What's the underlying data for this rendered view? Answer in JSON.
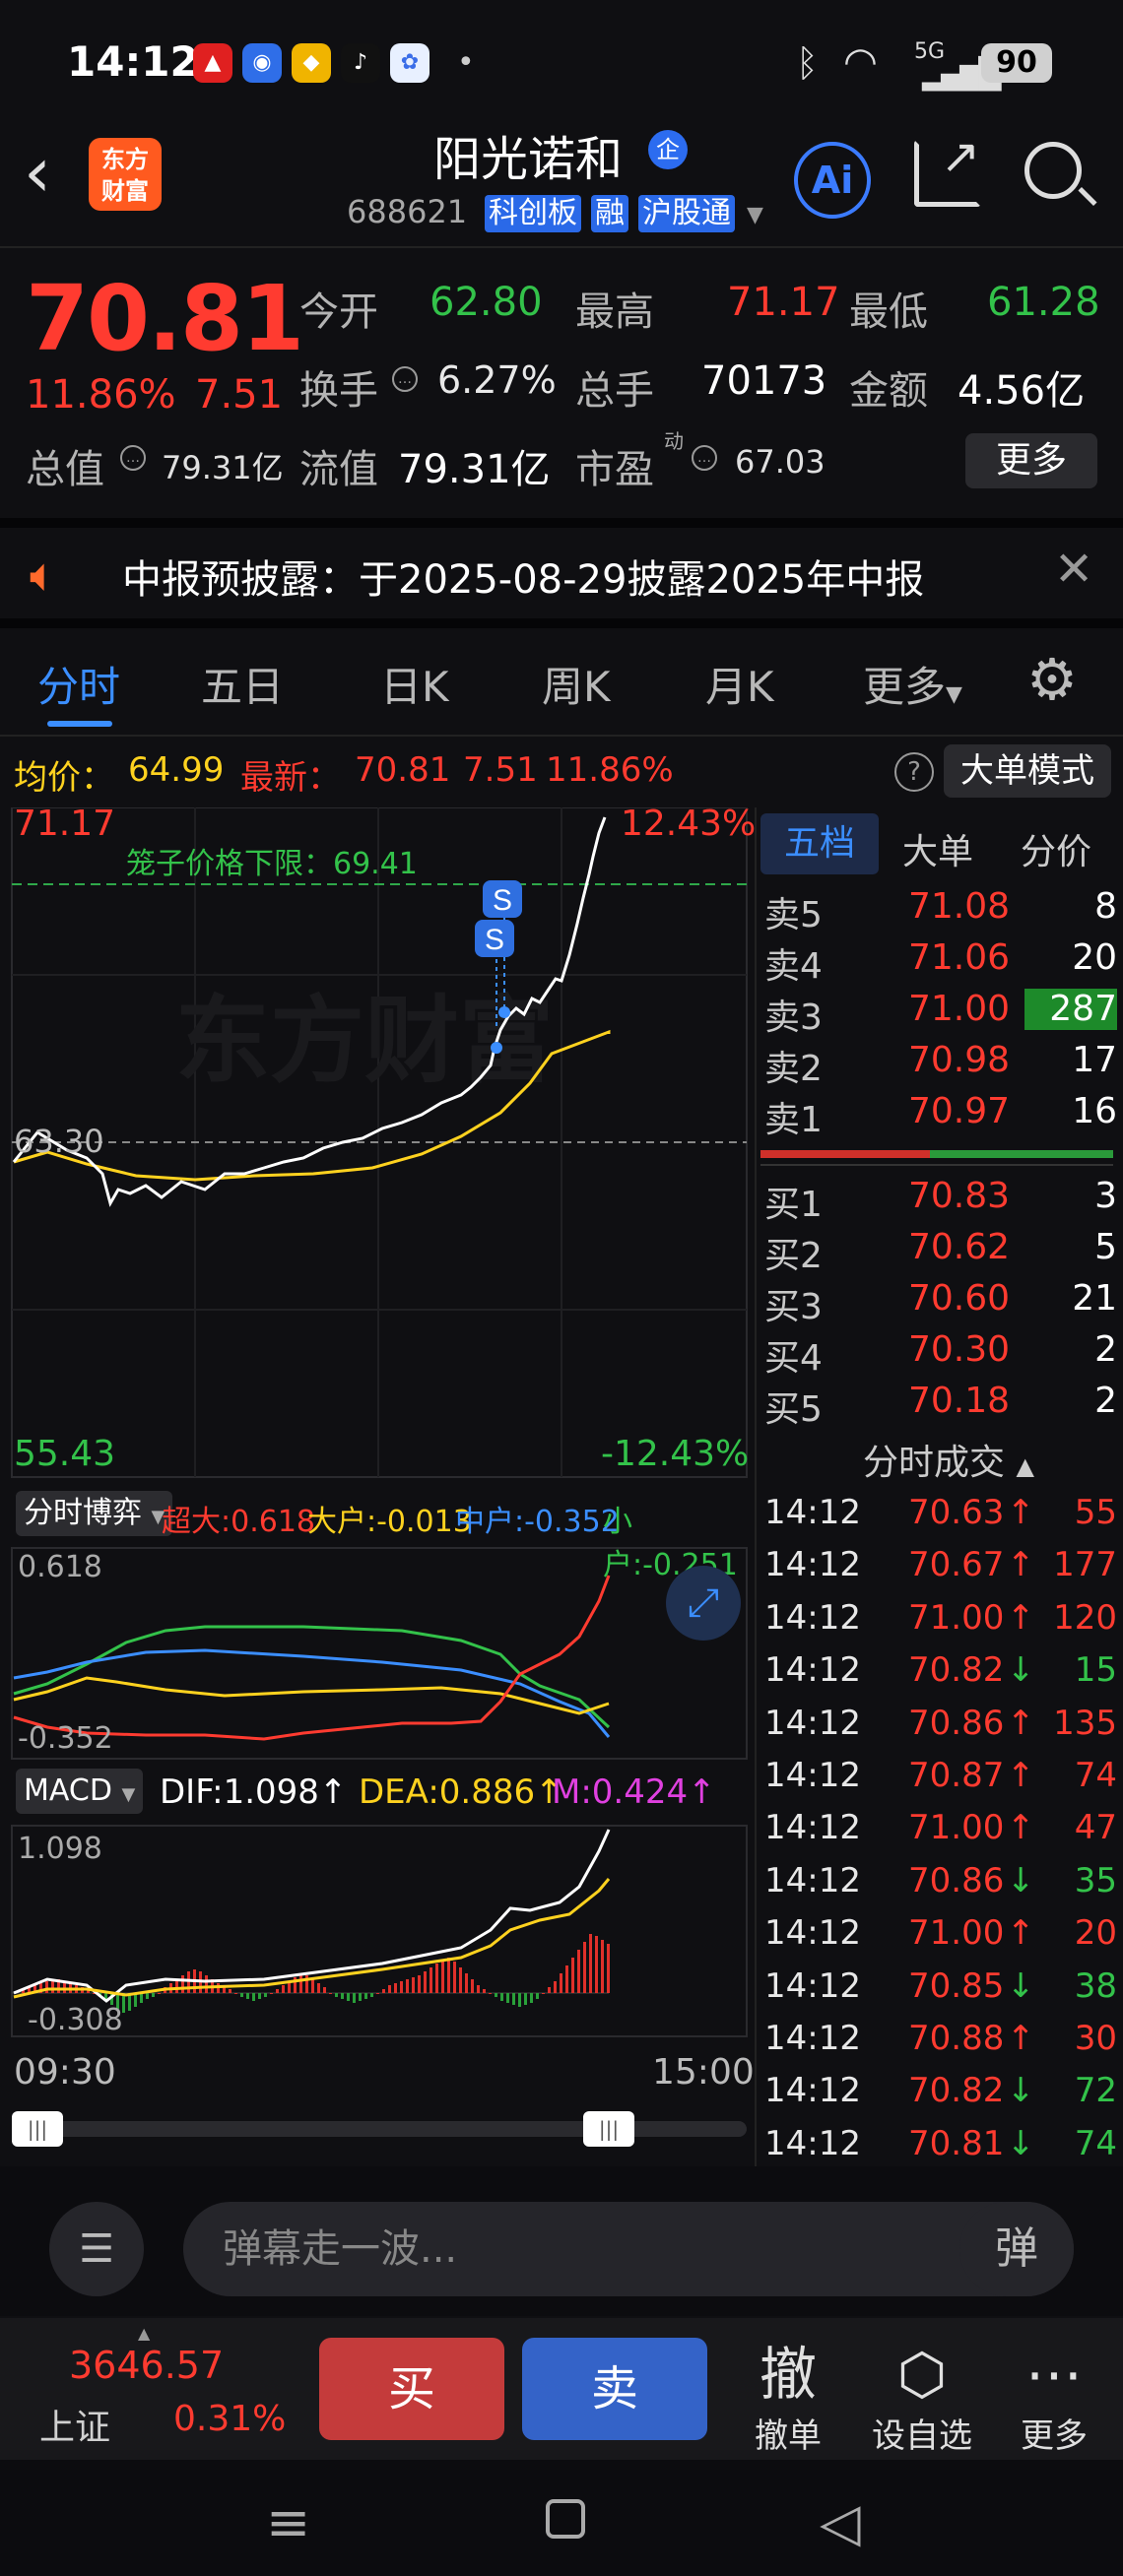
{
  "status": {
    "time": "14:12",
    "battery": "90",
    "net": "5G"
  },
  "header": {
    "logo": "东方\n财富",
    "title": "阳光诺和",
    "title_badge": "企",
    "code": "688621",
    "tags": [
      "科创板",
      "融",
      "沪股通"
    ],
    "ai_label": "Ai"
  },
  "quote": {
    "price": "70.81",
    "pct": "11.86%",
    "change": "7.51",
    "open_label": "今开",
    "open": "62.80",
    "high_label": "最高",
    "high": "71.17",
    "low_label": "最低",
    "low": "61.28",
    "turnover_label": "换手",
    "turnover": "6.27%",
    "volume_label": "总手",
    "volume": "70173",
    "amount_label": "金额",
    "amount": "4.56亿",
    "mktcap_label": "总值",
    "mktcap": "79.31亿",
    "float_label": "流值",
    "float": "79.31亿",
    "pe_label": "市盈",
    "pe_sup": "动",
    "pe": "67.03",
    "more": "更多"
  },
  "announcement": {
    "text": "中报预披露：于2025-08-29披露2025年中报"
  },
  "tabs": [
    "分时",
    "五日",
    "日K",
    "周K",
    "月K",
    "更多"
  ],
  "infoline": {
    "avg_label": "均价：",
    "avg": "64.99",
    "latest_label": "最新：",
    "latest": "70.81",
    "chg": "7.51",
    "pct": "11.86%",
    "help": "?",
    "big_order": "大单模式"
  },
  "chart": {
    "top_price": "71.17",
    "top_pct": "12.43%",
    "bottom_price": "55.43",
    "bottom_pct": "-12.43%",
    "cage_label": "笼子价格下限：69.41",
    "prev_close_label": "63.30",
    "watermark": "东方财富",
    "trade_marks": [
      "S",
      "S"
    ],
    "flow_selector": "分时博弈",
    "flow": {
      "super_label": "超大:",
      "super": "0.618",
      "large_label": "大户:",
      "large": "-0.013",
      "mid_label": "中户:",
      "mid": "-0.352",
      "small_label": "小户:",
      "small": "-0.251",
      "max": "0.618",
      "min": "-0.352"
    },
    "macd_selector": "MACD",
    "macd": {
      "dif": "DIF:1.098",
      "dea": "DEA:0.886",
      "m": "M:0.424",
      "arrow": "↑",
      "max": "1.098",
      "min": "-0.308"
    },
    "time_start": "09:30",
    "time_end": "15:00",
    "colors": {
      "price": "#ffffff",
      "avg": "#ffd21f",
      "super": "#ff3b30",
      "large": "#ffd21f",
      "mid": "#3b8eff",
      "small": "#33c24a"
    }
  },
  "book": {
    "tabs": [
      "五档",
      "大单",
      "分价"
    ],
    "asks": [
      {
        "label": "卖5",
        "price": "71.08",
        "vol": "8"
      },
      {
        "label": "卖4",
        "price": "71.06",
        "vol": "20"
      },
      {
        "label": "卖3",
        "price": "71.00",
        "vol": "287"
      },
      {
        "label": "卖2",
        "price": "70.98",
        "vol": "17"
      },
      {
        "label": "卖1",
        "price": "70.97",
        "vol": "16"
      }
    ],
    "bids": [
      {
        "label": "买1",
        "price": "70.83",
        "vol": "3"
      },
      {
        "label": "买2",
        "price": "70.62",
        "vol": "5"
      },
      {
        "label": "买3",
        "price": "70.60",
        "vol": "21"
      },
      {
        "label": "买4",
        "price": "70.30",
        "vol": "2"
      },
      {
        "label": "买5",
        "price": "70.18",
        "vol": "2"
      }
    ],
    "ticks_title": "分时成交",
    "ticks": [
      {
        "t": "14:12",
        "p": "70.63",
        "d": "↑",
        "v": "55"
      },
      {
        "t": "14:12",
        "p": "70.67",
        "d": "↑",
        "v": "177"
      },
      {
        "t": "14:12",
        "p": "71.00",
        "d": "↑",
        "v": "120"
      },
      {
        "t": "14:12",
        "p": "70.82",
        "d": "↓",
        "v": "15"
      },
      {
        "t": "14:12",
        "p": "70.86",
        "d": "↑",
        "v": "135"
      },
      {
        "t": "14:12",
        "p": "70.87",
        "d": "↑",
        "v": "74"
      },
      {
        "t": "14:12",
        "p": "71.00",
        "d": "↑",
        "v": "47"
      },
      {
        "t": "14:12",
        "p": "70.86",
        "d": "↓",
        "v": "35"
      },
      {
        "t": "14:12",
        "p": "71.00",
        "d": "↑",
        "v": "20"
      },
      {
        "t": "14:12",
        "p": "70.85",
        "d": "↓",
        "v": "38"
      },
      {
        "t": "14:12",
        "p": "70.88",
        "d": "↑",
        "v": "30"
      },
      {
        "t": "14:12",
        "p": "70.82",
        "d": "↓",
        "v": "72"
      },
      {
        "t": "14:12",
        "p": "70.81",
        "d": "↓",
        "v": "74"
      }
    ]
  },
  "danmu": {
    "placeholder": "弹幕走一波...",
    "toggle": "弹"
  },
  "trade": {
    "index_value": "3646.57",
    "index_name": "上证",
    "index_pct": "0.31%",
    "buy": "买",
    "sell": "卖",
    "actions": [
      {
        "icon": "撤",
        "label": "撤单"
      },
      {
        "icon": "⬡",
        "label": "设自选"
      },
      {
        "icon": "⋯",
        "label": "更多"
      }
    ]
  }
}
